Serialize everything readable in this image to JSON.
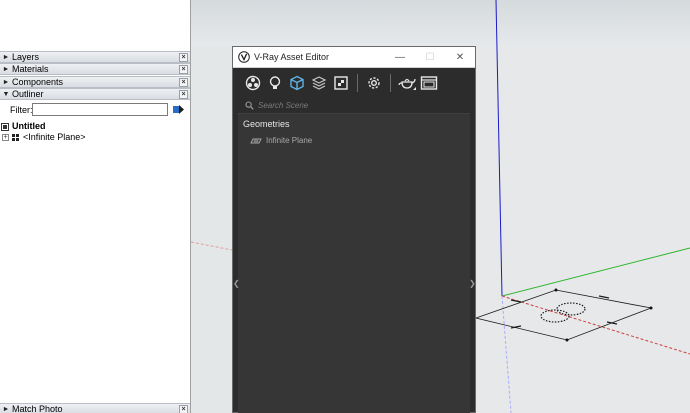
{
  "tray": {
    "panels": [
      {
        "title": "Layers",
        "expanded": false
      },
      {
        "title": "Materials",
        "expanded": false
      },
      {
        "title": "Components",
        "expanded": false
      },
      {
        "title": "Outliner",
        "expanded": true
      }
    ],
    "filter_label": "Filter:",
    "filter_value": "",
    "outliner": {
      "root": "Untitled",
      "children": [
        "<Infinite Plane>"
      ]
    },
    "bottom_panel": "Match Photo",
    "close_glyph": "×",
    "collapsed_glyph": "►",
    "expanded_glyph": "▼",
    "expand_glyph": "+"
  },
  "vray": {
    "title": "V-Ray Asset Editor",
    "minimize": "—",
    "maximize": "☐",
    "close": "✕",
    "search_placeholder": "Search Scene",
    "category": "Geometries",
    "items": [
      "Infinite Plane"
    ],
    "left_arrow": "❮",
    "right_arrow": "❯",
    "toolbar_icons": [
      "materials-icon",
      "lights-icon",
      "geometry-icon",
      "render-elements-icon",
      "textures-icon",
      "settings-icon",
      "render-teapot-icon",
      "frame-buffer-icon"
    ],
    "active_icon": "geometry-icon",
    "colors": {
      "accent": "#5fb3e6",
      "panel": "#363636",
      "toolbar": "#2c2c2c"
    }
  }
}
